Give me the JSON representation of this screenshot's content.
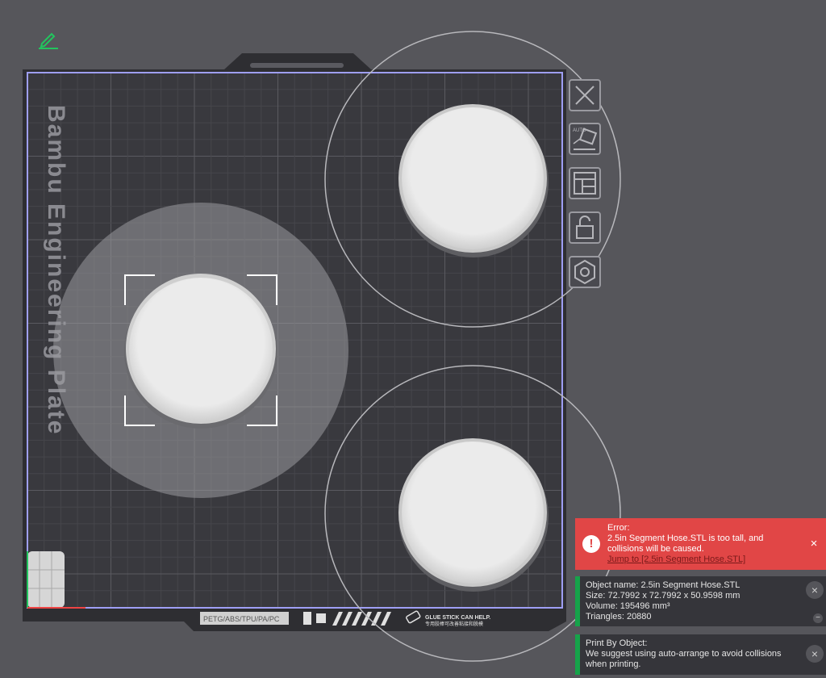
{
  "plate": {
    "name": "Bambu Engineering Plate",
    "footer_label": "PETG/ABS/TPU/PA/PC",
    "glue_line1": "GLUE STICK CAN HELP.",
    "glue_line2": "专用胶棒可改善粘接和脱模"
  },
  "toolbar": {
    "edit_icon": "pencil-icon",
    "tools": [
      {
        "name": "delete",
        "icon": "close-x-icon"
      },
      {
        "name": "auto-orient",
        "icon": "auto-orient-icon",
        "label": "AUTO"
      },
      {
        "name": "arrange",
        "icon": "arrange-layout-icon"
      },
      {
        "name": "lock",
        "icon": "unlock-icon"
      },
      {
        "name": "plate-settings",
        "icon": "hex-settings-icon"
      }
    ]
  },
  "notifications": {
    "error": {
      "title": "Error:",
      "message": "2.5in Segment Hose.STL is too tall, and collisions will be caused.",
      "link": "Jump to [2.5in Segment Hose.STL]",
      "icon": "!",
      "close": "×"
    },
    "object_info": {
      "name": "Object name: 2.5in Segment Hose.STL",
      "size": "Size: 72.7992 x 72.7992 x 50.9598 mm",
      "volume": "Volume: 195496 mm³",
      "triangles": "Triangles: 20880",
      "close": "×",
      "collapse": "−"
    },
    "print_by_object": {
      "title": "Print By Object:",
      "message": "We suggest using auto-arrange to avoid collisions when printing.",
      "close": "×"
    }
  },
  "colors": {
    "background": "#56565b",
    "plate": "#39393e",
    "grid": "#4f4f55",
    "plate_border": "#9f9ff5",
    "error": "#e14646",
    "accent": "#16a34a"
  }
}
